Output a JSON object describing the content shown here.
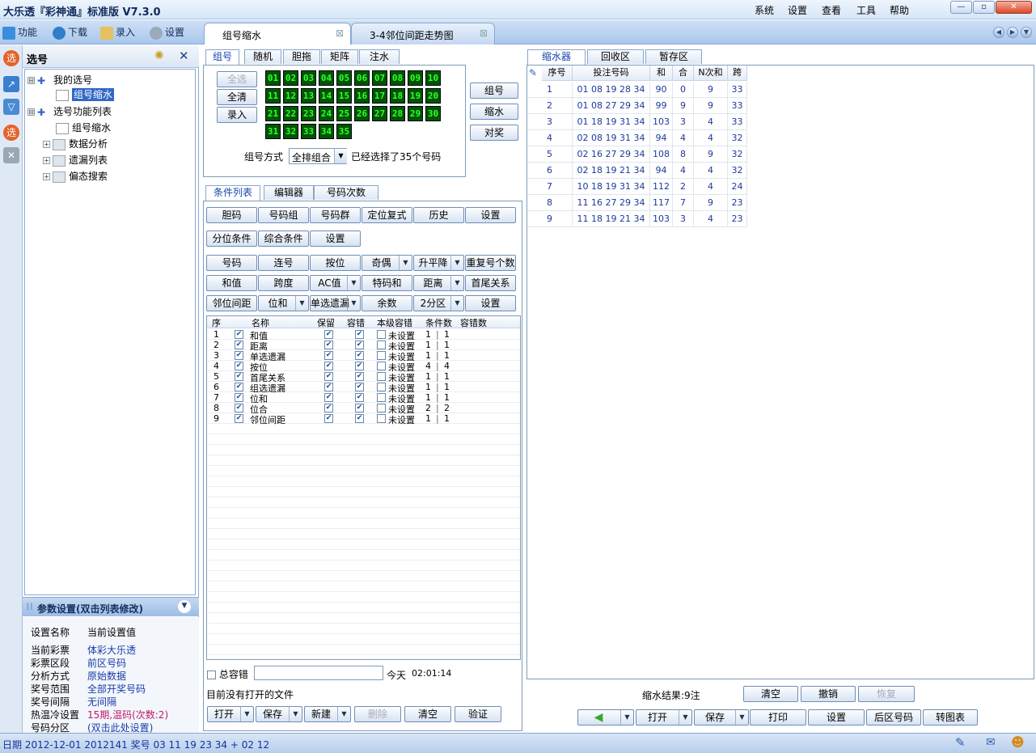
{
  "app": {
    "title": "大乐透『彩神通』标准版  V7.3.0",
    "menu": [
      "系统",
      "设置",
      "查看",
      "工具",
      "帮助"
    ]
  },
  "toolbar": {
    "items": [
      {
        "label": "功能",
        "icon": "plus-icon"
      },
      {
        "label": "下载",
        "icon": "download-icon"
      },
      {
        "label": "录入",
        "icon": "pencil-icon"
      },
      {
        "label": "设置",
        "icon": "gear-icon"
      }
    ],
    "tabs": [
      {
        "label": "组号缩水",
        "close": "⊠"
      },
      {
        "label": "3-4邻位间距走势图",
        "close": "⊠"
      }
    ]
  },
  "left": {
    "title": "选号",
    "tree": [
      {
        "label": "我的选号",
        "level": 0,
        "expander": "⊟"
      },
      {
        "label": "组号缩水",
        "level": 1,
        "selected": true
      },
      {
        "label": "选号功能列表",
        "level": 0,
        "expander": "⊟"
      },
      {
        "label": "组号缩水",
        "level": 1
      },
      {
        "label": "数据分析",
        "level": 1,
        "expander": "+"
      },
      {
        "label": "遗漏列表",
        "level": 1,
        "expander": "+"
      },
      {
        "label": "偏态搜索",
        "level": 1,
        "expander": "+"
      }
    ],
    "param_title": "参数设置(双击列表修改)",
    "param_header": {
      "k": "设置名称",
      "v": "当前设置值"
    },
    "params": [
      {
        "k": "当前彩票",
        "v": "体彩大乐透"
      },
      {
        "k": "彩票区段",
        "v": "前区号码"
      },
      {
        "k": "分析方式",
        "v": "原始数据"
      },
      {
        "k": "奖号范围",
        "v": "全部开奖号码"
      },
      {
        "k": "奖号间隔",
        "v": "无间隔"
      },
      {
        "k": "热温冷设置",
        "v": "15期,温码(次数:2)"
      },
      {
        "k": "号码分区",
        "v": "(双击此处设置)"
      }
    ]
  },
  "picker": {
    "tabs": [
      "组号",
      "随机",
      "胆拖",
      "矩阵",
      "注水"
    ],
    "buttons": [
      "全选",
      "全清",
      "录入"
    ],
    "numbers": [
      "01",
      "02",
      "03",
      "04",
      "05",
      "06",
      "07",
      "08",
      "09",
      "10",
      "11",
      "12",
      "13",
      "14",
      "15",
      "16",
      "17",
      "18",
      "19",
      "20",
      "21",
      "22",
      "23",
      "24",
      "25",
      "26",
      "27",
      "28",
      "29",
      "30",
      "31",
      "32",
      "33",
      "34",
      "35"
    ],
    "mode_label": "组号方式",
    "mode_value": "全排组合",
    "selected_text": "已经选择了35个号码",
    "side_buttons": [
      "组号",
      "缩水",
      "对奖"
    ]
  },
  "conditions": {
    "tabs": [
      "条件列表",
      "编辑器",
      "号码次数"
    ],
    "row1": [
      "胆码",
      "号码组",
      "号码群",
      "定位复式",
      "历史",
      "设置"
    ],
    "row2": [
      "分位条件",
      "综合条件",
      "设置"
    ],
    "row3": [
      "号码",
      "连号",
      "按位",
      "奇偶",
      "升平降",
      "重复号个数"
    ],
    "row4": [
      "和值",
      "跨度",
      "AC值",
      "特码和",
      "距离",
      "首尾关系"
    ],
    "row5": [
      "邻位间距",
      "位和",
      "单选遗漏",
      "余数",
      "2分区",
      "设置"
    ],
    "columns": [
      "序",
      "名称",
      "保留",
      "容错",
      "本级容错",
      "条件数",
      "容错数"
    ],
    "rows": [
      {
        "n": "1",
        "name": "和值",
        "status": "未设置",
        "cnt": "1",
        "err": "1"
      },
      {
        "n": "2",
        "name": "距离",
        "status": "未设置",
        "cnt": "1",
        "err": "1"
      },
      {
        "n": "3",
        "name": "单选遗漏",
        "status": "未设置",
        "cnt": "1",
        "err": "1"
      },
      {
        "n": "4",
        "name": "按位",
        "status": "未设置",
        "cnt": "4",
        "err": "4"
      },
      {
        "n": "5",
        "name": "首尾关系",
        "status": "未设置",
        "cnt": "1",
        "err": "1"
      },
      {
        "n": "6",
        "name": "组选遗漏",
        "status": "未设置",
        "cnt": "1",
        "err": "1"
      },
      {
        "n": "7",
        "name": "位和",
        "status": "未设置",
        "cnt": "1",
        "err": "1"
      },
      {
        "n": "8",
        "name": "位合",
        "status": "未设置",
        "cnt": "2",
        "err": "2"
      },
      {
        "n": "9",
        "name": "邻位间距",
        "status": "未设置",
        "cnt": "1",
        "err": "1"
      }
    ],
    "total_err_label": "总容错",
    "today_label": "今天",
    "time": "02:01:14",
    "file_status": "目前没有打开的文件",
    "bottom_buttons": [
      "打开",
      "保存",
      "新建",
      "删除",
      "清空",
      "验证"
    ]
  },
  "result": {
    "tabs": [
      "缩水器",
      "回收区",
      "暂存区"
    ],
    "columns": [
      "序号",
      "投注号码",
      "和",
      "合",
      "N次和",
      "跨"
    ],
    "rows": [
      {
        "n": "1",
        "nums": "01 08 19 28 34",
        "sum": "90",
        "he": "0",
        "nsum": "9",
        "span": "33"
      },
      {
        "n": "2",
        "nums": "01 08 27 29 34",
        "sum": "99",
        "he": "9",
        "nsum": "9",
        "span": "33"
      },
      {
        "n": "3",
        "nums": "01 18 19 31 34",
        "sum": "103",
        "he": "3",
        "nsum": "4",
        "span": "33"
      },
      {
        "n": "4",
        "nums": "02 08 19 31 34",
        "sum": "94",
        "he": "4",
        "nsum": "4",
        "span": "32"
      },
      {
        "n": "5",
        "nums": "02 16 27 29 34",
        "sum": "108",
        "he": "8",
        "nsum": "9",
        "span": "32"
      },
      {
        "n": "6",
        "nums": "02 18 19 21 34",
        "sum": "94",
        "he": "4",
        "nsum": "4",
        "span": "32"
      },
      {
        "n": "7",
        "nums": "10 18 19 31 34",
        "sum": "112",
        "he": "2",
        "nsum": "4",
        "span": "24"
      },
      {
        "n": "8",
        "nums": "11 16 27 29 34",
        "sum": "117",
        "he": "7",
        "nsum": "9",
        "span": "23"
      },
      {
        "n": "9",
        "nums": "11 18 19 21 34",
        "sum": "103",
        "he": "3",
        "nsum": "4",
        "span": "23"
      }
    ],
    "result_text": "缩水结果:9注",
    "action_buttons": [
      "清空",
      "撤销",
      "恢复"
    ],
    "bottom_buttons": [
      "打开",
      "保存",
      "打印",
      "设置",
      "后区号码",
      "转图表"
    ]
  },
  "status": {
    "text": "日期 2012-12-01 2012141 奖号 03 11 19 23 34 + 02 12"
  }
}
